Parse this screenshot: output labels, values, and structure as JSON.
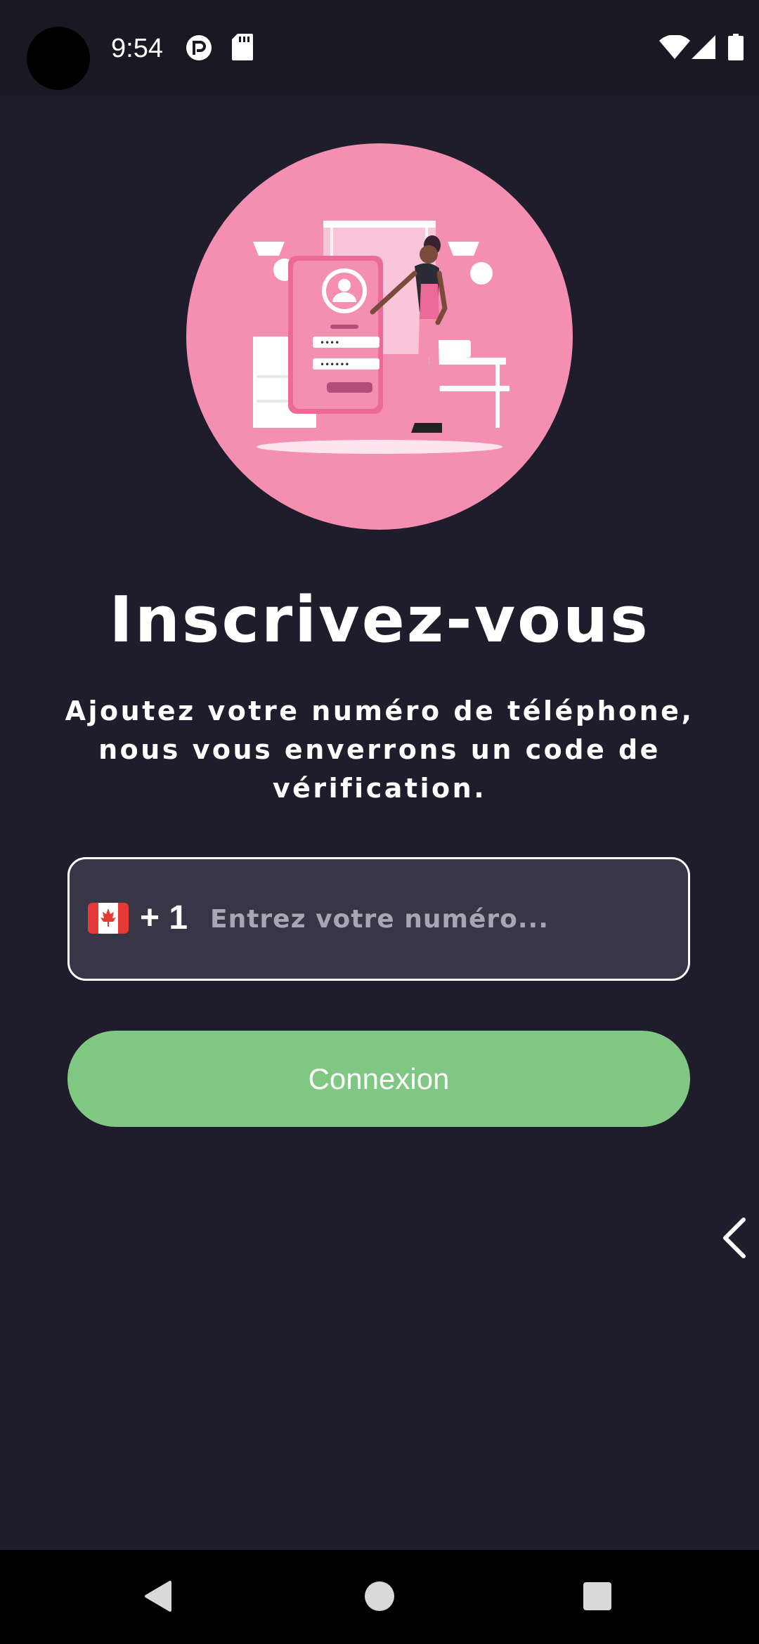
{
  "status_bar": {
    "time": "9:54",
    "icons": [
      "camera-cutout",
      "app-notification-icon",
      "sd-card-icon",
      "wifi-icon",
      "cellular-signal-icon",
      "battery-icon"
    ]
  },
  "hero": {
    "illustration": "sign-up-illustration",
    "background_color": "#f48fb1"
  },
  "title": "Inscrivez-vous",
  "subtitle": "Ajoutez votre numéro de téléphone, nous vous enverrons un code de vérification.",
  "phone_field": {
    "country_flag": "canada-flag-icon",
    "country_code": "+ 1",
    "value": "",
    "placeholder": "Entrez votre numéro..."
  },
  "connect_button": {
    "label": "Connexion",
    "color": "#81c784"
  },
  "side_handle": "chevron-left-icon",
  "nav_bar": {
    "buttons": [
      "back-triangle-icon",
      "home-circle-icon",
      "recents-square-icon"
    ]
  },
  "colors": {
    "background": "#1f1d2b",
    "field_background": "#383546",
    "accent_pink": "#f48fb1",
    "accent_green": "#81c784"
  }
}
